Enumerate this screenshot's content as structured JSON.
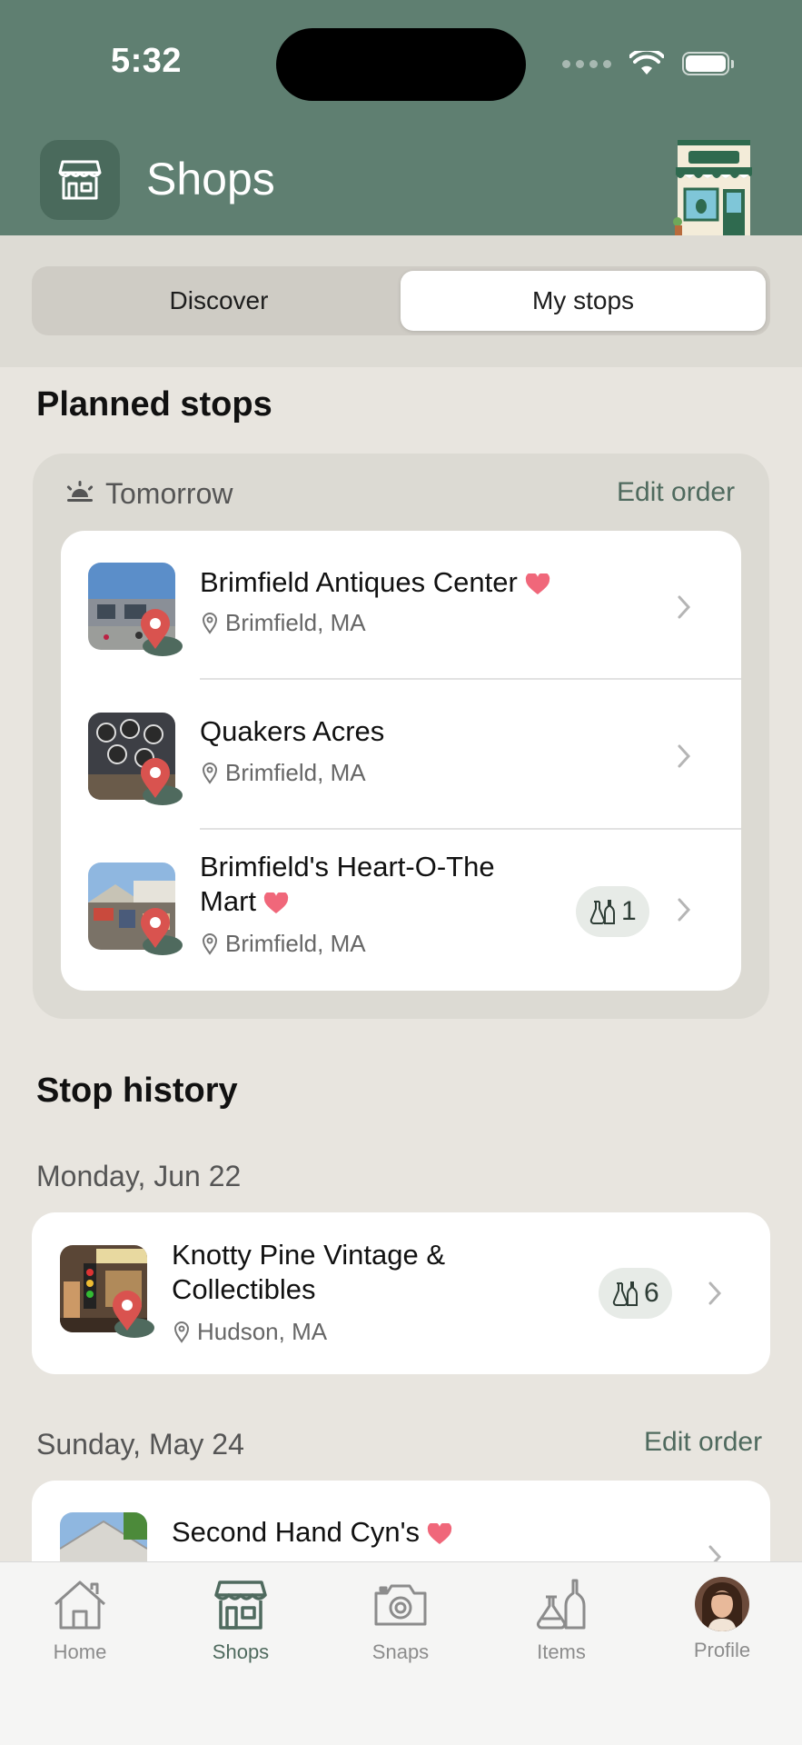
{
  "status": {
    "time": "5:32"
  },
  "header": {
    "title": "Shops"
  },
  "segmented": {
    "discover": "Discover",
    "my_stops": "My stops",
    "selected": "My stops"
  },
  "planned": {
    "title": "Planned stops",
    "day": "Tomorrow",
    "edit": "Edit order",
    "stops": [
      {
        "name": "Brimfield Antiques Center",
        "favorite": true,
        "location": "Brimfield, MA",
        "items": null
      },
      {
        "name": "Quakers Acres",
        "favorite": false,
        "location": "Brimfield, MA",
        "items": null
      },
      {
        "name_line1": "Brimfield's Heart-O-The",
        "name_line2": "Mart",
        "favorite": true,
        "location": "Brimfield, MA",
        "items": "1"
      }
    ]
  },
  "history": {
    "title": "Stop history",
    "groups": [
      {
        "date": "Monday, Jun 22",
        "stop": {
          "name_line1": "Knotty Pine Vintage &",
          "name_line2": "Collectibles",
          "location": "Hudson, MA",
          "items": "6"
        }
      },
      {
        "date": "Sunday, May 24",
        "edit": "Edit order",
        "stop": {
          "name": "Second Hand Cyn's",
          "favorite": true
        }
      }
    ]
  },
  "tabbar": {
    "items": [
      {
        "label": "Home",
        "icon": "house-icon"
      },
      {
        "label": "Shops",
        "icon": "store-icon",
        "active": true
      },
      {
        "label": "Snaps",
        "icon": "camera-icon"
      },
      {
        "label": "Items",
        "icon": "bottles-icon"
      },
      {
        "label": "Profile",
        "icon": "avatar"
      }
    ]
  },
  "colors": {
    "header": "#5f7f71",
    "accent": "#4f6a5e",
    "heart": "#f0677a",
    "pin": "#d9534f",
    "background": "#e8e5df"
  }
}
